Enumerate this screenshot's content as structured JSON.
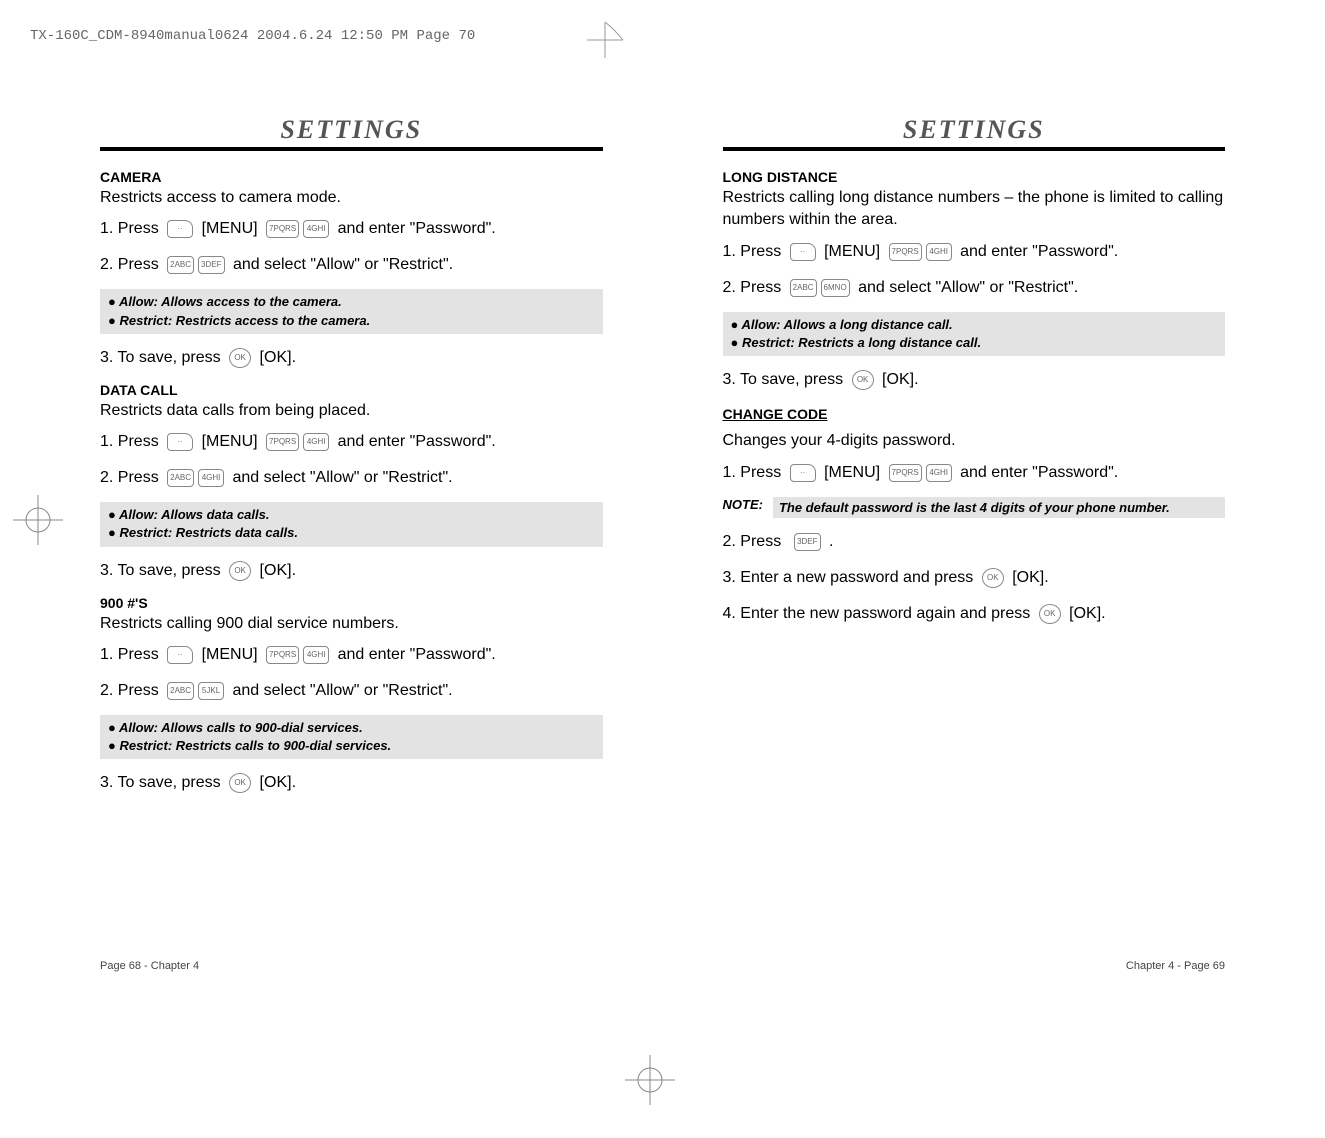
{
  "header_strip": "TX-160C_CDM-8940manual0624  2004.6.24  12:50 PM  Page 70",
  "left": {
    "title": "SETTINGS",
    "camera": {
      "heading": "CAMERA",
      "desc": "Restricts access to camera mode.",
      "step1a": "1. Press ",
      "step1b": " [MENU] ",
      "step1c": " and enter \"Password\".",
      "step2a": "2. Press ",
      "step2b": " and select \"Allow\" or \"Restrict\".",
      "note_allow": "●  Allow: Allows access to the camera.",
      "note_restrict": "●  Restrict: Restricts access to the camera.",
      "step3a": "3. To save, press ",
      "step3b": " [OK]."
    },
    "datacall": {
      "heading": "DATA CALL",
      "desc": "Restricts data calls from being placed.",
      "step1a": "1. Press ",
      "step1b": " [MENU] ",
      "step1c": " and enter \"Password\".",
      "step2a": "2. Press ",
      "step2b": " and select \"Allow\" or \"Restrict\".",
      "note_allow": "●  Allow: Allows data calls.",
      "note_restrict": "●  Restrict: Restricts data calls.",
      "step3a": "3. To save, press ",
      "step3b": " [OK]."
    },
    "nine": {
      "heading": "900 #'S",
      "desc": "Restricts calling 900 dial service numbers.",
      "step1a": "1. Press ",
      "step1b": " [MENU] ",
      "step1c": " and enter \"Password\".",
      "step2a": "2. Press ",
      "step2b": " and select \"Allow\" or \"Restrict\".",
      "note_allow": "●  Allow: Allows calls to 900-dial services.",
      "note_restrict": "●  Restrict: Restricts calls to 900-dial services.",
      "step3a": "3. To save, press ",
      "step3b": " [OK]."
    }
  },
  "right": {
    "title": "SETTINGS",
    "long": {
      "heading": "LONG DISTANCE",
      "desc": "Restricts calling long distance numbers – the phone is limited to calling numbers within the area.",
      "step1a": "1. Press ",
      "step1b": " [MENU] ",
      "step1c": " and enter \"Password\".",
      "step2a": "2. Press ",
      "step2b": " and select \"Allow\" or \"Restrict\".",
      "note_allow": "●  Allow: Allows a long distance call.",
      "note_restrict": "●  Restrict: Restricts a long distance call.",
      "step3a": "3. To save, press ",
      "step3b": " [OK]."
    },
    "change": {
      "heading": "CHANGE CODE",
      "desc": "Changes your 4-digits password.",
      "step1a": "1. Press ",
      "step1b": " [MENU] ",
      "step1c": " and enter \"Password\".",
      "note_label": "NOTE:",
      "note_body": "The default password is the last 4 digits of your phone number.",
      "step2a": "2. Press  ",
      "step2b": " .",
      "step3a": "3. Enter a new password and press ",
      "step3b": " [OK].",
      "step4a": "4. Enter the new password again and press ",
      "step4b": " [OK]."
    }
  },
  "keys": {
    "menu": "··",
    "seven": "7PQRS",
    "four": "4GHI",
    "two": "2ABC",
    "three": "3DEF",
    "five": "5JKL",
    "six": "6MNO",
    "ok": "OK"
  },
  "footer": {
    "left": "Page 68 - Chapter 4",
    "right": "Chapter 4 - Page 69"
  }
}
